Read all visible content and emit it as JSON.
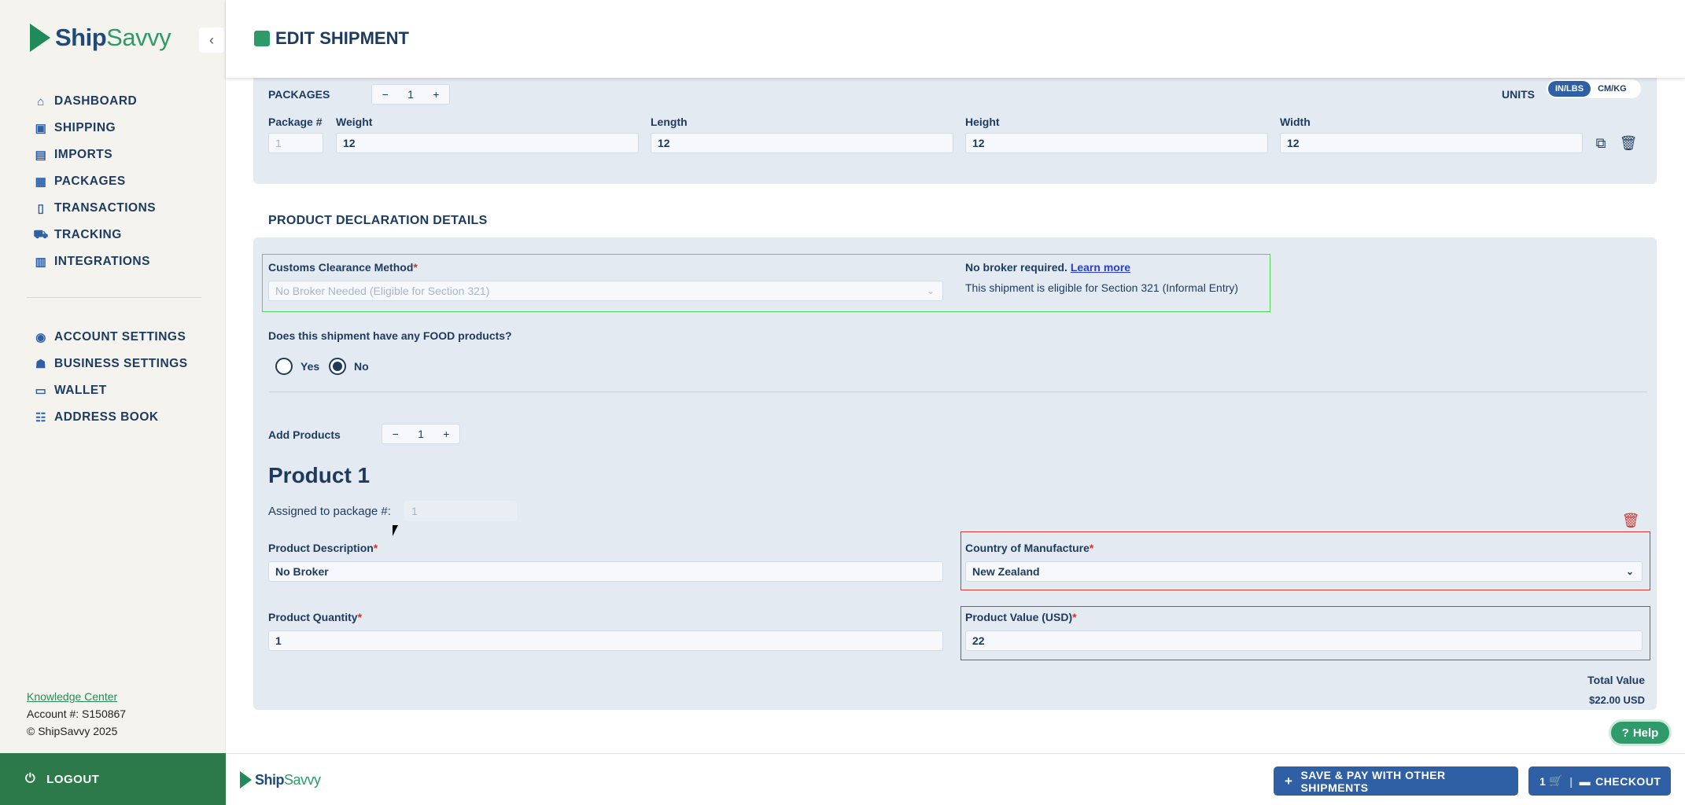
{
  "brand": {
    "name_part1": "Ship",
    "name_part2": "Savvy"
  },
  "sidebar": {
    "collapse_icon": "chevron-left-icon",
    "nav_main": [
      {
        "label": "DASHBOARD",
        "icon": "home-icon"
      },
      {
        "label": "SHIPPING",
        "icon": "box-icon"
      },
      {
        "label": "IMPORTS",
        "icon": "import-icon"
      },
      {
        "label": "PACKAGES",
        "icon": "packages-icon"
      },
      {
        "label": "TRANSACTIONS",
        "icon": "document-icon"
      },
      {
        "label": "TRACKING",
        "icon": "tracking-icon"
      },
      {
        "label": "INTEGRATIONS",
        "icon": "store-icon"
      }
    ],
    "nav_settings": [
      {
        "label": "ACCOUNT SETTINGS",
        "icon": "user-circle-icon"
      },
      {
        "label": "BUSINESS SETTINGS",
        "icon": "business-icon"
      },
      {
        "label": "WALLET",
        "icon": "wallet-icon"
      },
      {
        "label": "ADDRESS BOOK",
        "icon": "address-book-icon"
      }
    ],
    "knowledge_center": "Knowledge Center",
    "account_number": "Account #: S150867",
    "copyright": "© ShipSavvy 2025",
    "logout": "LOGOUT"
  },
  "header": {
    "title": "EDIT SHIPMENT"
  },
  "packages": {
    "label": "PACKAGES",
    "count": "1",
    "units_label": "UNITS",
    "units_options": [
      "IN/LBS",
      "CM/KG"
    ],
    "units_selected": "IN/LBS",
    "columns": {
      "package": "Package #",
      "weight": "Weight",
      "length": "Length",
      "height": "Height",
      "width": "Width"
    },
    "row": {
      "package": "1",
      "weight": "12",
      "length": "12",
      "height": "12",
      "width": "12"
    }
  },
  "declaration": {
    "title": "PRODUCT DECLARATION DETAILS",
    "customs_label": "Customs Clearance Method",
    "customs_value": "No Broker Needed (Eligible for Section 321)",
    "broker_note": "No broker required.",
    "learn_more": "Learn more",
    "eligibility_note": "This shipment is eligible for Section 321 (Informal Entry)",
    "food_question": "Does this shipment have any FOOD products?",
    "food_options": [
      "Yes",
      "No"
    ],
    "food_selected": "No",
    "add_products_label": "Add Products",
    "products_count": "1",
    "product": {
      "title": "Product 1",
      "assigned_label": "Assigned to package #:",
      "assigned_value": "1",
      "description_label": "Product Description",
      "description_value": "No Broker",
      "country_label": "Country of Manufacture",
      "country_value": "New Zealand",
      "quantity_label": "Product Quantity",
      "quantity_value": "1",
      "value_label": "Product Value (USD)",
      "value_value": "22"
    },
    "total_label": "Total Value",
    "total_value": "$22.00 USD"
  },
  "footer": {
    "save_pay": "SAVE & PAY WITH OTHER SHIPMENTS",
    "cart_count": "1",
    "checkout": "CHECKOUT"
  },
  "help": "Help",
  "colors": {
    "primary": "#2f5fa5",
    "brand_green": "#2c7a4a",
    "highlight_green": "#55d656",
    "highlight_red": "#d63a2f"
  }
}
